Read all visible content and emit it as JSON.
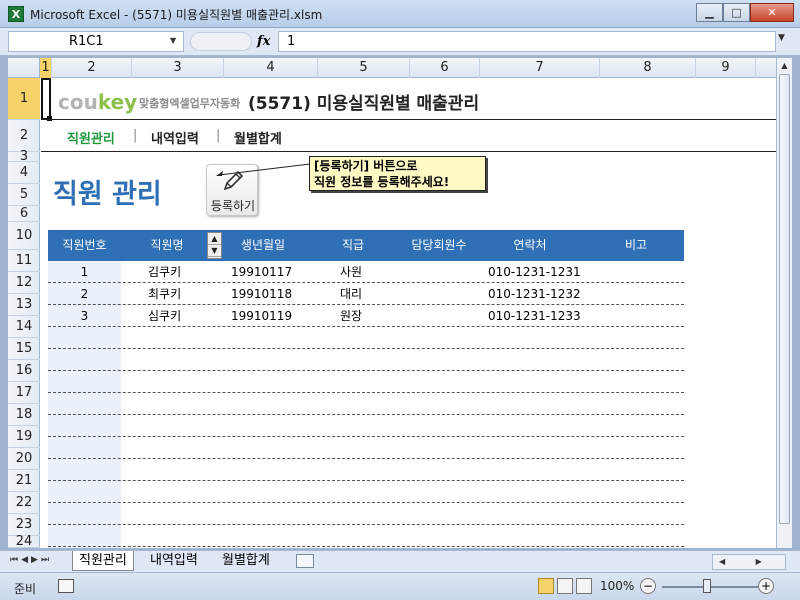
{
  "window": {
    "title": "Microsoft Excel - (5571) 미용실직원별 매출관리.xlsm",
    "app_icon": "X",
    "controls": {
      "minimize": "▁",
      "maximize": "□",
      "close": "✕"
    }
  },
  "formula_bar": {
    "name_box": "R1C1",
    "fx": "fx",
    "value": "1"
  },
  "columns": [
    "1",
    "2",
    "3",
    "4",
    "5",
    "6",
    "7",
    "8",
    "9"
  ],
  "rows": [
    "1",
    "2",
    "3",
    "4",
    "5",
    "6",
    "10",
    "11",
    "12",
    "13",
    "14",
    "15",
    "16",
    "17",
    "18",
    "19",
    "20",
    "21",
    "22",
    "23",
    "24"
  ],
  "header": {
    "brand_cou": "cou",
    "brand_key": "key",
    "brand_tag": "맞춤형엑셀업무자동화",
    "title": "(5571) 미용실직원별 매출관리"
  },
  "nav": {
    "items": [
      "직원관리",
      "내역입력",
      "월별합계"
    ],
    "separator": "|"
  },
  "section": {
    "title": "직원 관리",
    "register_button": "등록하기",
    "callout_line1": "[등록하기] 버튼으로",
    "callout_line2": "직원 정보를 등록해주세요!"
  },
  "table": {
    "headers": [
      "직원번호",
      "직원명",
      "생년월일",
      "직급",
      "담당회원수",
      "연락처",
      "비고"
    ],
    "spin_up": "▲",
    "spin_down": "▼",
    "rows": [
      [
        "1",
        "김쿠키",
        "19910117",
        "사원",
        "",
        "010-1231-1231",
        ""
      ],
      [
        "2",
        "최쿠키",
        "19910118",
        "대리",
        "",
        "010-1231-1232",
        ""
      ],
      [
        "3",
        "심쿠키",
        "19910119",
        "원장",
        "",
        "010-1231-1233",
        ""
      ]
    ],
    "empty_rows": 10
  },
  "sheet_tabs": {
    "nav_arrows": "⏮◀▶⏭",
    "tabs": [
      "직원관리",
      "내역입력",
      "월별합계"
    ],
    "active": 0
  },
  "status_bar": {
    "status": "준비",
    "zoom": "100%",
    "zoom_level_percent": 100
  },
  "colors": {
    "accent_blue": "#2e6fb5",
    "nav_active_green": "#1f9a3f",
    "callout_yellow": "#fff9c4"
  }
}
